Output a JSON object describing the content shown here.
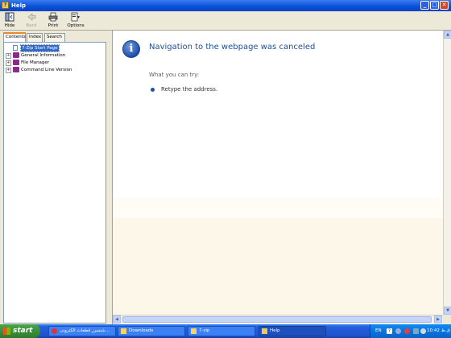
{
  "window": {
    "title": "Help",
    "minimize_glyph": "_",
    "maximize_glyph": "□",
    "close_glyph": "✕"
  },
  "toolbar": {
    "hide_label": "Hide",
    "back_label": "Back",
    "print_label": "Print",
    "options_label": "Options"
  },
  "nav": {
    "tabs": [
      {
        "label": "Contents"
      },
      {
        "label": "Index"
      },
      {
        "label": "Search"
      }
    ],
    "tree": [
      {
        "label": "7-Zip Start Page",
        "selected": true
      },
      {
        "label": "General Information"
      },
      {
        "label": "File Manager"
      },
      {
        "label": "Command Line Version"
      }
    ],
    "expand_glyph": "+"
  },
  "content": {
    "heading": "Navigation to the webpage was canceled",
    "try_heading": "What you can try:",
    "items": [
      "Retype the address."
    ],
    "info_glyph": "i"
  },
  "taskbar": {
    "start_label": "start",
    "tasks": [
      {
        "label": "شتسرر قطعات الكترونی...",
        "icon": "browser-icon"
      },
      {
        "label": "Downloads",
        "icon": "folder-icon"
      },
      {
        "label": "7-zip",
        "icon": "folder-icon"
      },
      {
        "label": "Help",
        "icon": "help-icon",
        "active": true
      }
    ],
    "language": "EN",
    "clock": "10:42 ق.ظ"
  },
  "colors": {
    "title_bar": "#0a4fd6",
    "heading_blue": "#1f4f9c",
    "selection": "#316ac5",
    "book_icon": "#8b2a8a",
    "start_green": "#3a8f3a"
  }
}
